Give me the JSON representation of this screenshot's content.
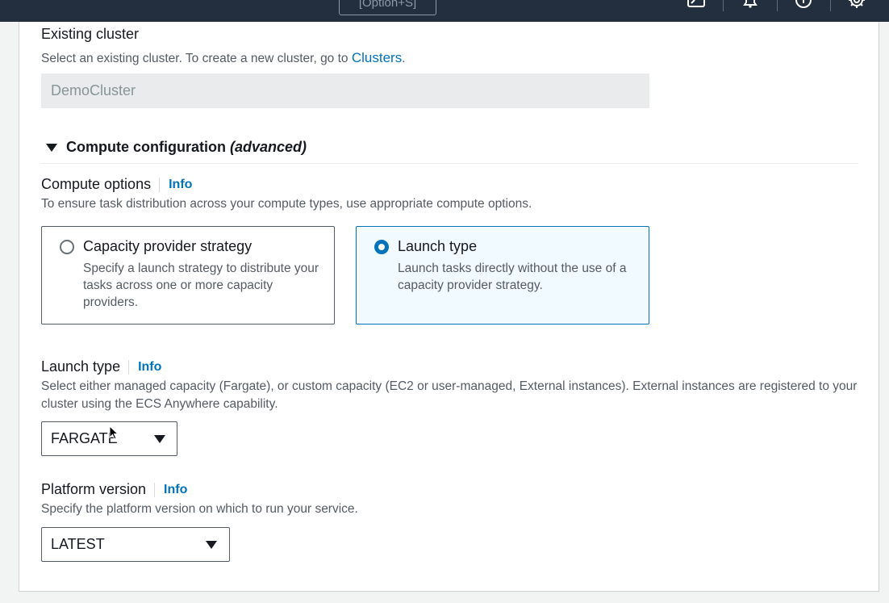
{
  "topbar": {
    "search_shortcut": "[Option+S]",
    "icons": [
      "cloudshell-icon",
      "notifications-icon",
      "help-icon",
      "settings-icon"
    ]
  },
  "cluster": {
    "label": "Existing cluster",
    "desc_prefix": "Select an existing cluster. To create a new cluster, go to ",
    "desc_link": "Clusters",
    "desc_suffix": ".",
    "value": "DemoCluster"
  },
  "compute_config": {
    "title": "Compute configuration",
    "title_suffix": "(advanced)"
  },
  "compute_options": {
    "label": "Compute options",
    "info": "Info",
    "desc": "To ensure task distribution across your compute types, use appropriate compute options.",
    "tiles": [
      {
        "title": "Capacity provider strategy",
        "desc": "Specify a launch strategy to distribute your tasks across one or more capacity providers.",
        "selected": false
      },
      {
        "title": "Launch type",
        "desc": "Launch tasks directly without the use of a capacity provider strategy.",
        "selected": true
      }
    ]
  },
  "launch_type": {
    "label": "Launch type",
    "info": "Info",
    "desc": "Select either managed capacity (Fargate), or custom capacity (EC2 or user-managed, External instances). External instances are registered to your cluster using the ECS Anywhere capability.",
    "value": "FARGATE"
  },
  "platform_version": {
    "label": "Platform version",
    "info": "Info",
    "desc": "Specify the platform version on which to run your service.",
    "value": "LATEST"
  },
  "colors": {
    "accent": "#0073bb",
    "selected_bg": "#f1faff",
    "topbar": "#232f3e"
  }
}
